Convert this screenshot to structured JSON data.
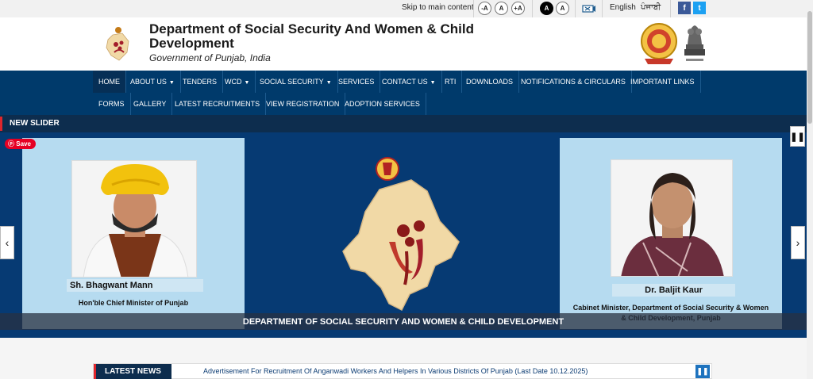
{
  "topbar": {
    "skip_label": "Skip to main content",
    "font_buttons": [
      "-A",
      "A",
      "+A",
      "A",
      "A"
    ],
    "lang_english": "English",
    "lang_punjabi": "ਪੰਜਾਬੀ",
    "facebook": "f",
    "twitter": "t"
  },
  "header": {
    "title": "Department of Social Security And Women & Child Development",
    "subtitle": "Government of Punjab, India"
  },
  "nav": {
    "row1": [
      {
        "label": "HOME",
        "dropdown": false
      },
      {
        "label": "ABOUT US",
        "dropdown": true
      },
      {
        "label": "TENDERS",
        "dropdown": false
      },
      {
        "label": "WCD",
        "dropdown": true
      },
      {
        "label": "SOCIAL SECURITY",
        "dropdown": true
      },
      {
        "label": "SERVICES",
        "dropdown": false
      },
      {
        "label": "CONTACT US",
        "dropdown": true
      },
      {
        "label": "RTI",
        "dropdown": false
      },
      {
        "label": "DOWNLOADS",
        "dropdown": false
      },
      {
        "label": "NOTIFICATIONS & CIRCULARS",
        "dropdown": false
      },
      {
        "label": "IMPORTANT LINKS",
        "dropdown": false
      }
    ],
    "row2": [
      {
        "label": "FORMS",
        "dropdown": false
      },
      {
        "label": "GALLERY",
        "dropdown": false
      },
      {
        "label": "LATEST RECRUITMENTS",
        "dropdown": false
      },
      {
        "label": "VIEW REGISTRATION",
        "dropdown": false
      },
      {
        "label": "ADOPTION SERVICES",
        "dropdown": false
      }
    ]
  },
  "slider": {
    "section_title": "NEW SLIDER",
    "pin_label": "Save",
    "left_person": {
      "name": "Sh. Bhagwant Mann",
      "role": "Hon'ble Chief Minister of Punjab"
    },
    "right_person": {
      "name": "Dr. Baljit Kaur",
      "role": "Cabinet Minister, Department of Social Security & Women & Child Development, Punjab"
    },
    "caption": "DEPARTMENT OF SOCIAL SECURITY AND WOMEN & CHILD DEVELOPMENT",
    "prev_icon": "‹",
    "next_icon": "›",
    "pause_icon": "❚❚"
  },
  "news": {
    "label": "LATEST NEWS",
    "headline": "Advertisement For Recruitment Of Anganwadi Workers And Helpers In Various Districts Of Punjab (Last Date 10.12.2025)",
    "pause_icon": "❚❚"
  },
  "colors": {
    "nav_bg": "#003a6b",
    "slider_bg": "#063a73",
    "accent_red": "#e0262c",
    "panel_bg": "#b6dbf0"
  }
}
